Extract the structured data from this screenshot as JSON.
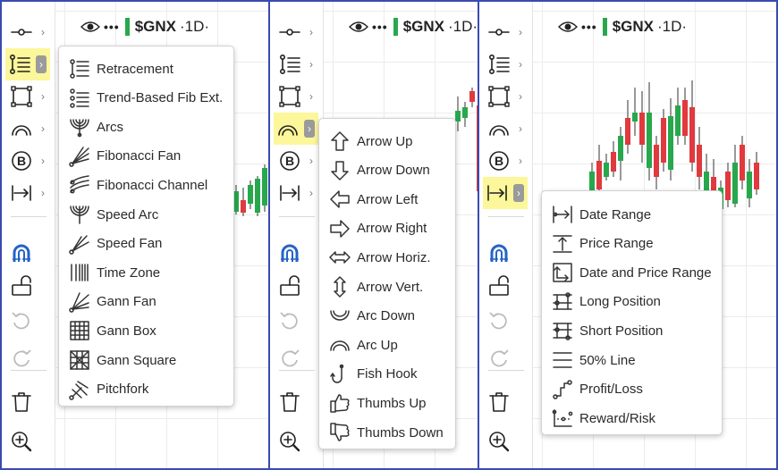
{
  "chart": {
    "symbol": "$GNX",
    "timeframe": "·1D·",
    "dots": "•••"
  },
  "colors": {
    "up": "#27a84d",
    "down": "#e0393e",
    "highlight": "#fbf79a",
    "magnet": "#2563c7",
    "frame": "#3a4ab0"
  },
  "toolbar": [
    {
      "icon": "cursor-line-icon"
    },
    {
      "icon": "fibonacci-icon"
    },
    {
      "icon": "rectangle-icon"
    },
    {
      "icon": "arc-icon"
    },
    {
      "icon": "b-circle-icon"
    },
    {
      "icon": "measure-icon"
    },
    {
      "icon": "magnet-icon"
    },
    {
      "icon": "unlock-icon"
    },
    {
      "icon": "undo-icon"
    },
    {
      "icon": "redo-icon"
    },
    {
      "icon": "trash-icon"
    },
    {
      "icon": "zoom-in-icon"
    }
  ],
  "fib_menu": [
    {
      "label": "Retracement",
      "icon": "retracement-icon"
    },
    {
      "label": "Trend-Based Fib Ext.",
      "icon": "trend-fib-ext-icon"
    },
    {
      "label": "Arcs",
      "icon": "fib-arcs-icon"
    },
    {
      "label": "Fibonacci Fan",
      "icon": "fib-fan-icon"
    },
    {
      "label": "Fibonacci Channel",
      "icon": "fib-channel-icon"
    },
    {
      "label": "Speed Arc",
      "icon": "speed-arc-icon"
    },
    {
      "label": "Speed Fan",
      "icon": "speed-fan-icon"
    },
    {
      "label": "Time Zone",
      "icon": "time-zone-icon"
    },
    {
      "label": "Gann Fan",
      "icon": "gann-fan-icon"
    },
    {
      "label": "Gann Box",
      "icon": "gann-box-icon"
    },
    {
      "label": "Gann Square",
      "icon": "gann-square-icon"
    },
    {
      "label": "Pitchfork",
      "icon": "pitchfork-icon"
    }
  ],
  "shape_menu": [
    {
      "label": "Arrow Up",
      "icon": "arrow-up-icon"
    },
    {
      "label": "Arrow Down",
      "icon": "arrow-down-icon"
    },
    {
      "label": "Arrow Left",
      "icon": "arrow-left-icon"
    },
    {
      "label": "Arrow Right",
      "icon": "arrow-right-icon"
    },
    {
      "label": "Arrow Horiz.",
      "icon": "arrow-horizontal-icon"
    },
    {
      "label": "Arrow Vert.",
      "icon": "arrow-vertical-icon"
    },
    {
      "label": "Arc Down",
      "icon": "arc-down-icon"
    },
    {
      "label": "Arc Up",
      "icon": "arc-up-icon"
    },
    {
      "label": "Fish Hook",
      "icon": "fish-hook-icon"
    },
    {
      "label": "Thumbs Up",
      "icon": "thumbs-up-icon"
    },
    {
      "label": "Thumbs Down",
      "icon": "thumbs-down-icon"
    }
  ],
  "measure_menu": [
    {
      "label": "Date Range",
      "icon": "date-range-icon"
    },
    {
      "label": "Price Range",
      "icon": "price-range-icon"
    },
    {
      "label": "Date and Price Range",
      "icon": "date-price-range-icon"
    },
    {
      "label": "Long Position",
      "icon": "long-position-icon"
    },
    {
      "label": "Short Position",
      "icon": "short-position-icon"
    },
    {
      "label": "50% Line",
      "icon": "fifty-line-icon"
    },
    {
      "label": "Profit/Loss",
      "icon": "profit-loss-icon"
    },
    {
      "label": "Reward/Risk",
      "icon": "reward-risk-icon"
    }
  ]
}
